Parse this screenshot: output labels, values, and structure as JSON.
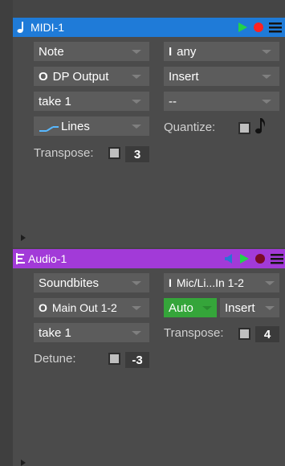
{
  "midi_track": {
    "title": "MIDI-1",
    "accent": "#1f7bd8",
    "field_note": "Note",
    "field_any": "any",
    "field_output": "DP Output",
    "field_insert": "Insert",
    "field_take": "take 1",
    "field_dash": "--",
    "field_lines": "Lines",
    "quantize_label": "Quantize:",
    "transpose_label": "Transpose:",
    "transpose_value": "3"
  },
  "audio_track": {
    "title": "Audio-1",
    "accent": "#a23ad8",
    "field_soundbites": "Soundbites",
    "field_input": "Mic/Li...In 1-2",
    "field_output": "Main Out 1-2",
    "field_auto": "Auto",
    "field_insert": "Insert",
    "field_take": "take 1",
    "transpose_label": "Transpose:",
    "transpose_value": "4",
    "detune_label": "Detune:",
    "detune_value": "-3"
  },
  "icons": {
    "midi_note_icon": "music-note-icon",
    "audio_wave_icon": "audio-track-icon",
    "play_icon": "play-icon",
    "record_icon": "record-icon",
    "menu_icon": "hamburger-menu-icon",
    "speaker_icon": "speaker-icon",
    "quantize_note_icon": "eighth-note-icon"
  }
}
